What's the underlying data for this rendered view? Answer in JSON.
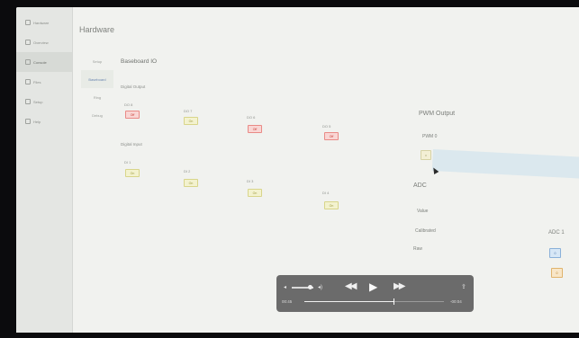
{
  "sidebar": {
    "items": [
      {
        "label": "Hardware",
        "icon": "chip-icon"
      },
      {
        "label": "Overview",
        "icon": "home-icon"
      },
      {
        "label": "Console",
        "icon": "terminal-icon"
      },
      {
        "label": "Files",
        "icon": "folder-icon"
      },
      {
        "label": "Setup",
        "icon": "gear-icon"
      },
      {
        "label": "Help",
        "icon": "help-icon"
      }
    ]
  },
  "header": {
    "title": "Hardware"
  },
  "subnav": {
    "items": [
      "Setup",
      "Baseboard",
      "Ring",
      "Debug"
    ]
  },
  "baseboard": {
    "title": "Baseboard IO",
    "digital_output": {
      "label": "Digital Output",
      "channels": [
        {
          "name": "DO 8",
          "state": "Off"
        },
        {
          "name": "DO 7",
          "state": "On"
        },
        {
          "name": "DO 6",
          "state": "Off"
        },
        {
          "name": "DO 5",
          "state": "Off"
        }
      ]
    },
    "digital_input": {
      "label": "Digital Input",
      "channels": [
        {
          "name": "DI 1",
          "state": "On"
        },
        {
          "name": "DI 2",
          "state": "On"
        },
        {
          "name": "DI 3",
          "state": "On"
        },
        {
          "name": "DI 4",
          "state": "On"
        }
      ]
    }
  },
  "pwm": {
    "title": "PWM Output",
    "channel": "PWM 0",
    "value": "0"
  },
  "adc": {
    "title": "ADC",
    "rows": [
      "Value",
      "Calibrated",
      "Raw"
    ],
    "channel": "ADC 1",
    "calibrated_value": "0",
    "raw_value": "0"
  },
  "player": {
    "elapsed": "00:45",
    "remaining": "-00:04",
    "progress": 0.64,
    "volume": 0.85
  }
}
